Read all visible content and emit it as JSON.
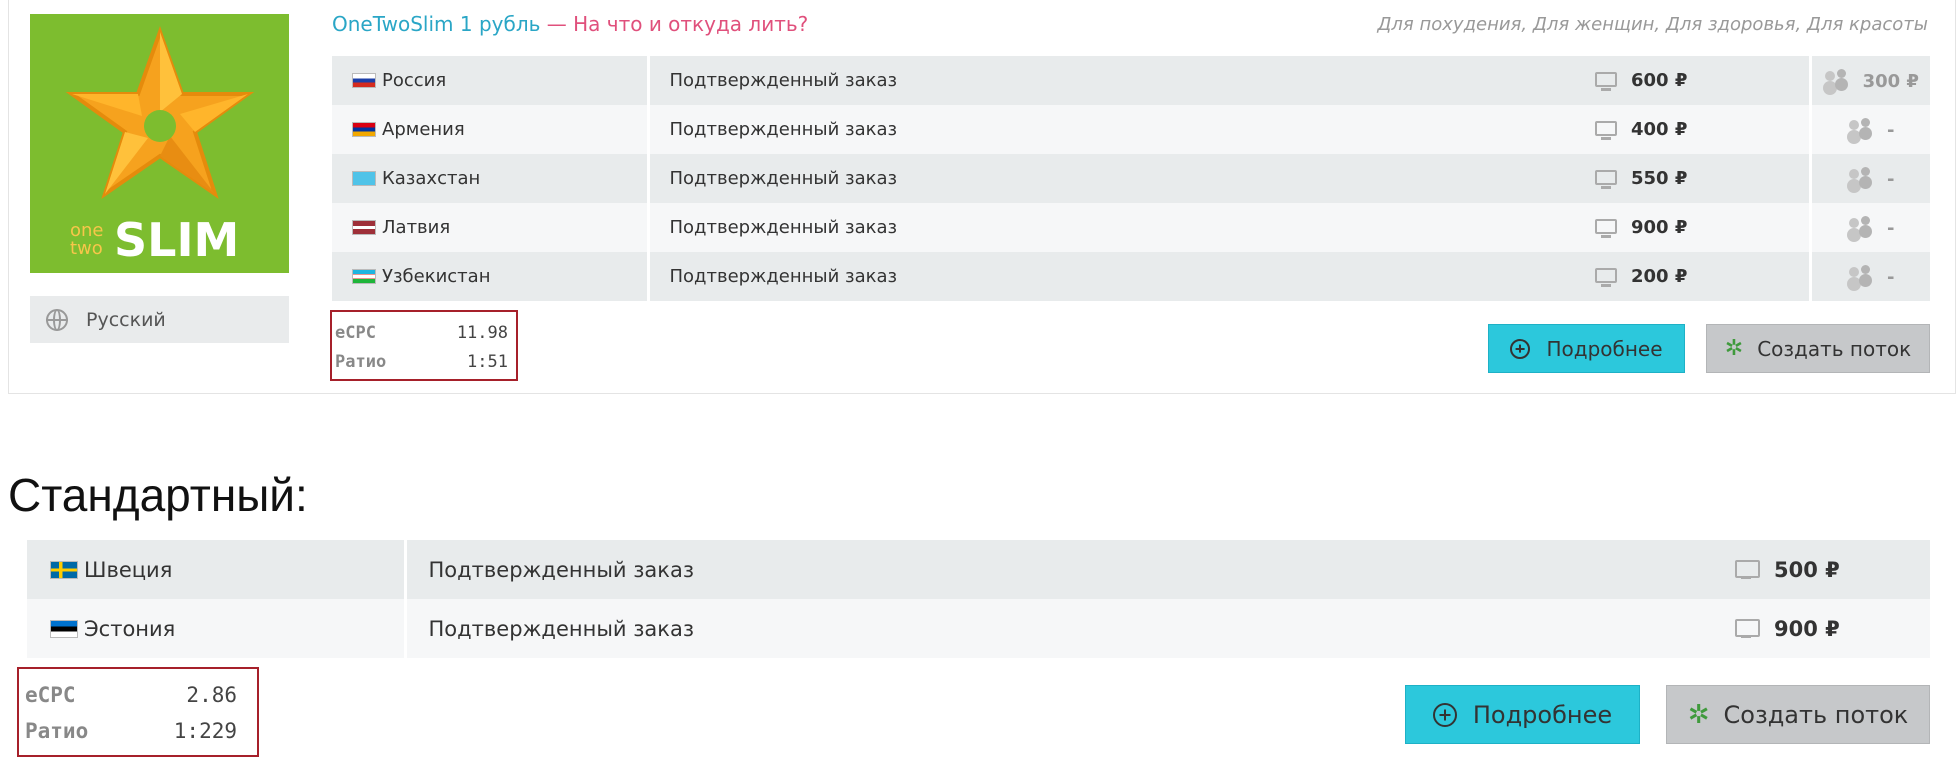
{
  "offer1": {
    "title_main": "OneTwoSlim 1 рубль",
    "title_sub": " — На что и откуда лить?",
    "categories": "Для похудения, Для женщин, Для здоровья, Для красоты",
    "logo_text_one": "one",
    "logo_text_two": "two",
    "logo_text_slim": "SLIM",
    "language": "Русский",
    "rows": [
      {
        "country": "Россия",
        "goal": "Подтвержденный заказ",
        "web_price": "600 ₽",
        "mobile_price": "300 ₽"
      },
      {
        "country": "Армения",
        "goal": "Подтвержденный заказ",
        "web_price": "400 ₽",
        "mobile_price": "-"
      },
      {
        "country": "Казахстан",
        "goal": "Подтвержденный заказ",
        "web_price": "550 ₽",
        "mobile_price": "-"
      },
      {
        "country": "Латвия",
        "goal": "Подтвержденный заказ",
        "web_price": "900 ₽",
        "mobile_price": "-"
      },
      {
        "country": "Узбекистан",
        "goal": "Подтвержденный заказ",
        "web_price": "200 ₽",
        "mobile_price": "-"
      }
    ],
    "stats": {
      "ecpc_label": "eCPC",
      "ecpc_value": "11.98",
      "ratio_label": "Ратио",
      "ratio_value": "1:51"
    },
    "more_button": "Подробнее",
    "create_button": "Создать поток"
  },
  "section_heading": "Стандартный:",
  "offer2": {
    "rows": [
      {
        "country": "Швеция",
        "goal": "Подтвержденный заказ",
        "web_price": "500 ₽"
      },
      {
        "country": "Эстония",
        "goal": "Подтвержденный заказ",
        "web_price": "900 ₽"
      }
    ],
    "stats": {
      "ecpc_label": "eCPC",
      "ecpc_value": "2.86",
      "ratio_label": "Ратио",
      "ratio_value": "1:229"
    },
    "more_button": "Подробнее",
    "create_button": "Создать поток"
  },
  "colors": {
    "accent_button": "#2cc8dc",
    "secondary_button": "#c6c8ca",
    "highlight_border": "#a6202a",
    "title_link": "#2aa6c6",
    "title_subtitle": "#e0507c",
    "logo_green": "#7dbd2f"
  },
  "icons": {
    "language": "globe-icon",
    "web_price": "monitor-icon",
    "mobile_price": "people-icon",
    "more": "plus-circle-icon",
    "create": "gear-icon"
  }
}
